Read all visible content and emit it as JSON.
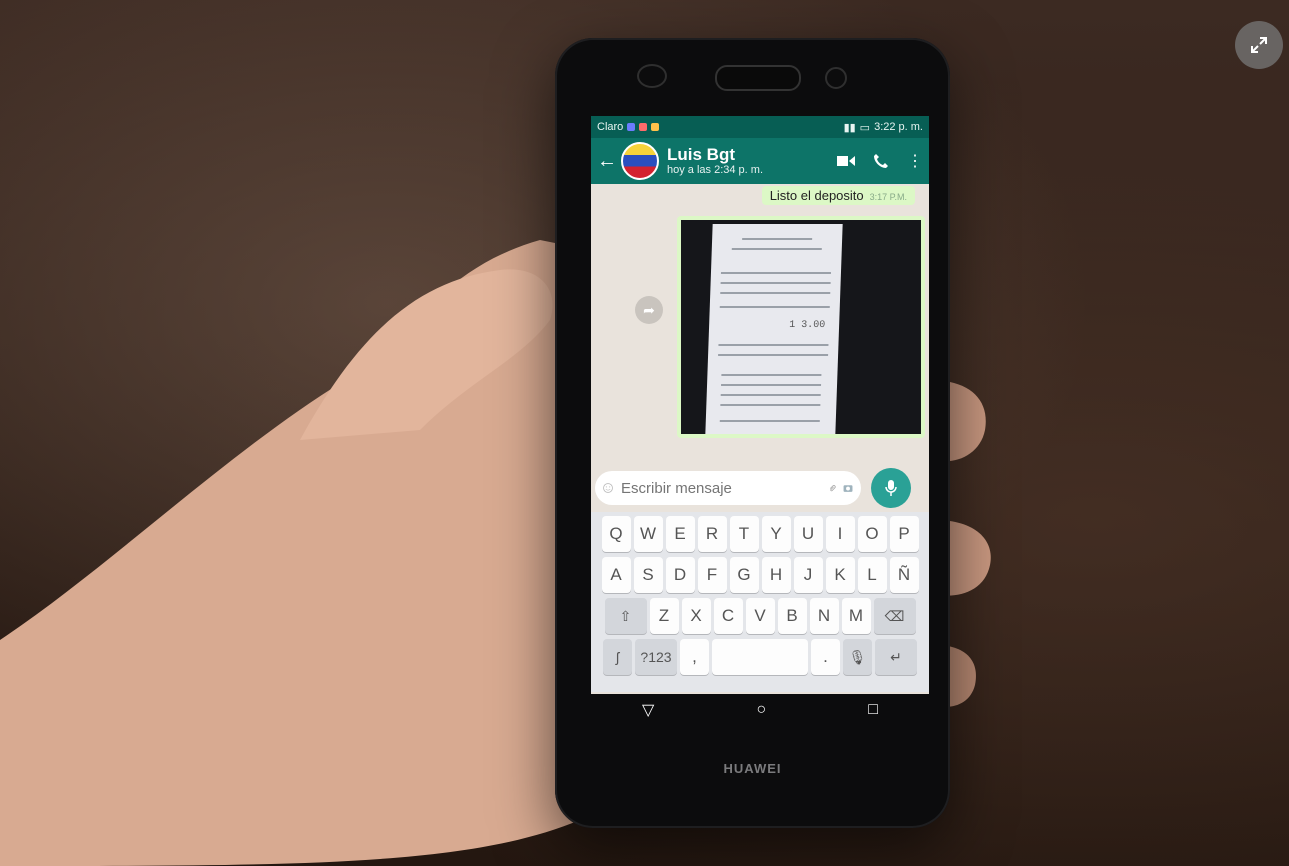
{
  "status_bar": {
    "carrier": "Claro",
    "time": "3:22 p. m."
  },
  "chat_header": {
    "contact_name": "Luis Bgt",
    "last_seen": "hoy a las 2:34 p. m."
  },
  "messages": [
    {
      "text": "Listo el deposito",
      "time": "3:17 P.M."
    }
  ],
  "receipt_amount": "1 3.00",
  "input": {
    "placeholder": "Escribir mensaje"
  },
  "keyboard": {
    "row1": [
      "Q",
      "W",
      "E",
      "R",
      "T",
      "Y",
      "U",
      "I",
      "O",
      "P"
    ],
    "row2": [
      "A",
      "S",
      "D",
      "F",
      "G",
      "H",
      "J",
      "K",
      "L",
      "Ñ"
    ],
    "row3": [
      "Z",
      "X",
      "C",
      "V",
      "B",
      "N",
      "M"
    ],
    "numbers_key": "?123",
    "comma": ",",
    "period": "."
  },
  "device_brand": "HUAWEI",
  "colors": {
    "whatsapp_header": "#0d7468",
    "status_bar": "#075e54",
    "mic_button": "#2aa196",
    "sent_bubble": "#dcf8c6"
  },
  "icons": [
    "expand-icon",
    "back-arrow-icon",
    "video-call-icon",
    "phone-icon",
    "more-icon",
    "forward-icon",
    "emoji-icon",
    "attach-icon",
    "camera-icon",
    "mic-icon",
    "shift-icon",
    "backspace-icon",
    "enter-icon",
    "nav-back-icon",
    "nav-home-icon",
    "nav-recents-icon"
  ]
}
